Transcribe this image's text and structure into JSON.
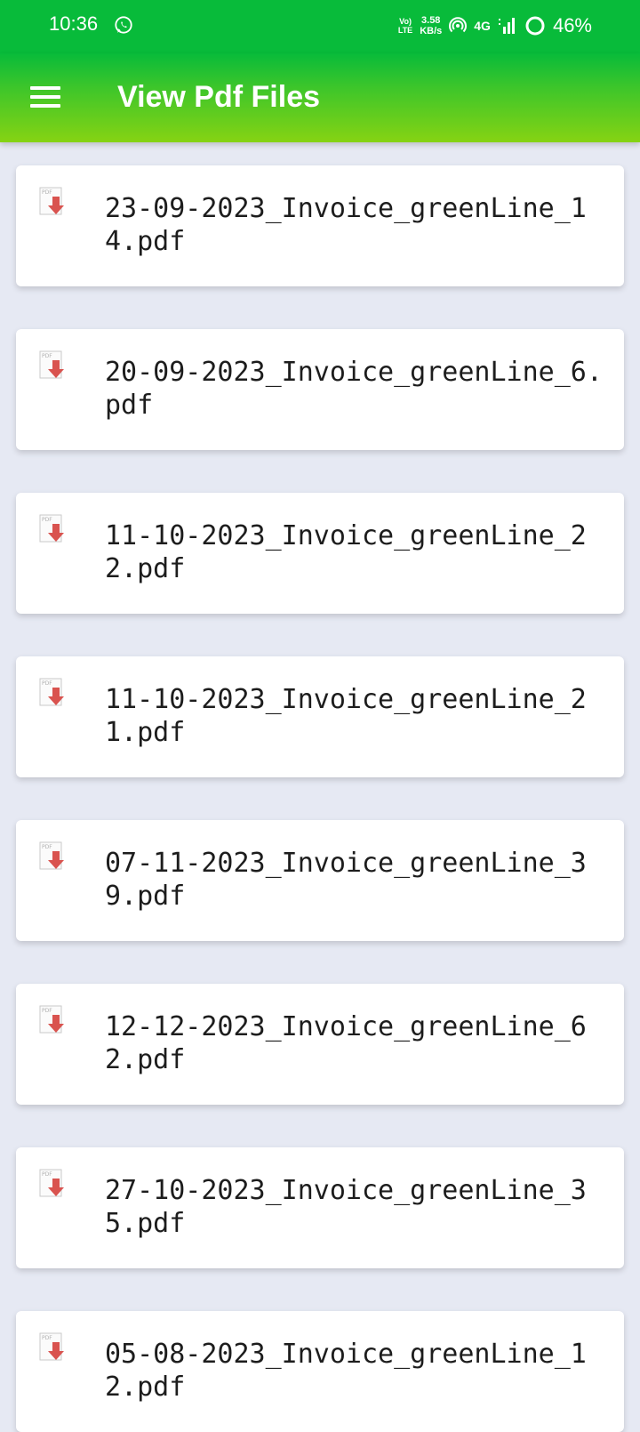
{
  "status_bar": {
    "time": "10:36",
    "volte_line1": "Vo)",
    "volte_line2": "LTE",
    "speed_value": "3.58",
    "speed_unit": "KB/s",
    "network": "4G",
    "battery": "46%"
  },
  "app_bar": {
    "title": "View Pdf Files"
  },
  "files": [
    {
      "name": "23-09-2023_Invoice_greenLine_14.pdf"
    },
    {
      "name": "20-09-2023_Invoice_greenLine_6.pdf"
    },
    {
      "name": "11-10-2023_Invoice_greenLine_22.pdf"
    },
    {
      "name": "11-10-2023_Invoice_greenLine_21.pdf"
    },
    {
      "name": "07-11-2023_Invoice_greenLine_39.pdf"
    },
    {
      "name": "12-12-2023_Invoice_greenLine_62.pdf"
    },
    {
      "name": "27-10-2023_Invoice_greenLine_35.pdf"
    },
    {
      "name": "05-08-2023_Invoice_greenLine_12.pdf"
    }
  ],
  "icons": {
    "menu": "hamburger-menu-icon",
    "file": "pdf-download-icon",
    "whatsapp": "whatsapp-icon"
  },
  "colors": {
    "status_bar": "#08bb3a",
    "app_bar_bottom": "#86d313",
    "background": "#e6e9f3",
    "pdf_arrow": "#d9534f"
  }
}
